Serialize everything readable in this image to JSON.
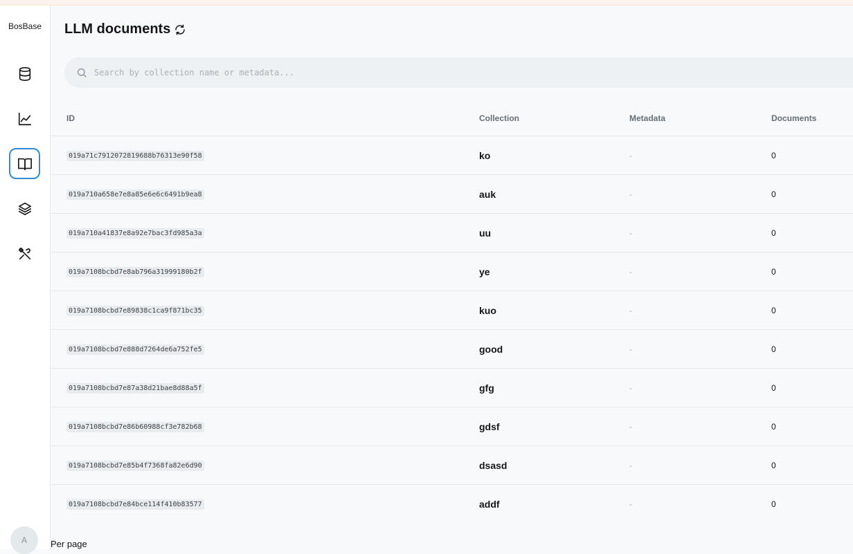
{
  "app": {
    "logo": "BosBase"
  },
  "sidebar": {
    "items": [
      {
        "icon": "database-icon",
        "active": false
      },
      {
        "icon": "chart-line-icon",
        "active": false
      },
      {
        "icon": "book-open-icon",
        "active": true
      },
      {
        "icon": "layers-icon",
        "active": false
      },
      {
        "icon": "tools-icon",
        "active": false
      }
    ],
    "avatar": "A"
  },
  "header": {
    "title": "LLM documents",
    "refresh_icon": "refresh-icon"
  },
  "search": {
    "placeholder": "Search by collection name or metadata...",
    "value": ""
  },
  "table": {
    "columns": [
      "ID",
      "Collection",
      "Metadata",
      "Documents"
    ],
    "rows": [
      {
        "id": "019a71c7912072819688b76313e90f58",
        "collection": "ko",
        "metadata": "-",
        "documents": "0"
      },
      {
        "id": "019a710a658e7e8a85e6e6c6491b9ea8",
        "collection": "auk",
        "metadata": "-",
        "documents": "0"
      },
      {
        "id": "019a710a41837e8a92e7bac3fd985a3a",
        "collection": "uu",
        "metadata": "-",
        "documents": "0"
      },
      {
        "id": "019a7108bcbd7e8ab796a31999180b2f",
        "collection": "ye",
        "metadata": "-",
        "documents": "0"
      },
      {
        "id": "019a7108bcbd7e89838c1ca9f871bc35",
        "collection": "kuo",
        "metadata": "-",
        "documents": "0"
      },
      {
        "id": "019a7108bcbd7e888d7264de6a752fe5",
        "collection": "good",
        "metadata": "-",
        "documents": "0"
      },
      {
        "id": "019a7108bcbd7e87a38d21bae8d88a5f",
        "collection": "gfg",
        "metadata": "-",
        "documents": "0"
      },
      {
        "id": "019a7108bcbd7e86b60988cf3e782b68",
        "collection": "gdsf",
        "metadata": "-",
        "documents": "0"
      },
      {
        "id": "019a7108bcbd7e85b4f7368fa82e6d90",
        "collection": "dsasd",
        "metadata": "-",
        "documents": "0"
      },
      {
        "id": "019a7108bcbd7e84bce114f410b83577",
        "collection": "addf",
        "metadata": "-",
        "documents": "0"
      }
    ]
  },
  "footer": {
    "per_page_label": "Per page"
  },
  "colors": {
    "accent": "#2e8bd6"
  }
}
